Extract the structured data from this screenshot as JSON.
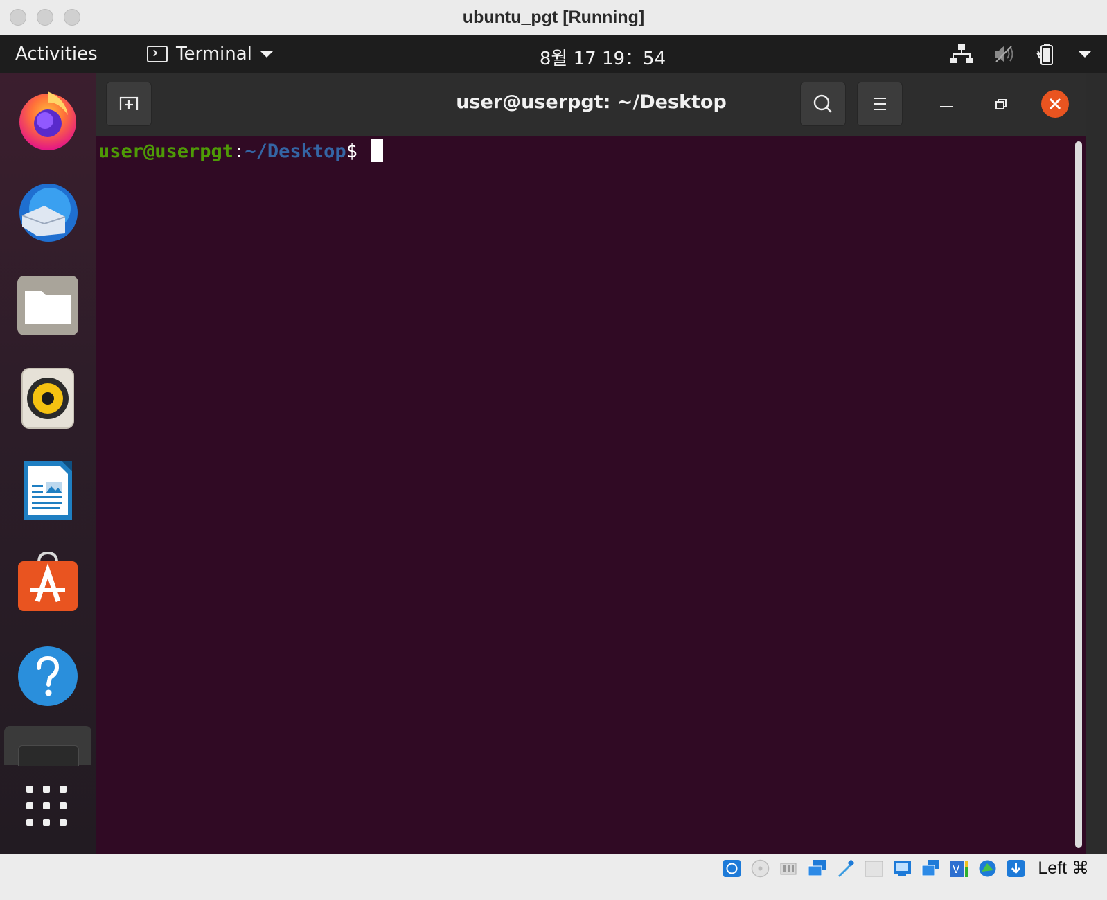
{
  "host": {
    "title": "ubuntu_pgt [Running]",
    "host_key_label": "Left ⌘",
    "status_icons": [
      "hard-disk-icon",
      "optical-disk-icon",
      "audio-icon",
      "network-icon",
      "usb-icon",
      "shared-folders-icon",
      "display-icon",
      "capture-icon",
      "video-capture-icon",
      "guest-additions-icon",
      "mouse-integration-icon"
    ]
  },
  "topbar": {
    "activities": "Activities",
    "app_menu": "Terminal",
    "clock": "8월 17  19：54",
    "tray_icons": [
      "network-wired-icon",
      "volume-muted-icon",
      "battery-icon",
      "system-menu-caret-icon"
    ]
  },
  "dock": {
    "apps": [
      "Firefox",
      "Thunderbird",
      "Files",
      "Rhythmbox",
      "LibreOffice Writer",
      "Ubuntu Software",
      "Help",
      "Terminal"
    ],
    "show_apps": "Show Applications"
  },
  "terminal": {
    "title": "user@userpgt: ~/Desktop",
    "prompt_user": "user@userpgt",
    "prompt_colon": ":",
    "prompt_path": "~/Desktop",
    "prompt_dollar": "$ ",
    "colors": {
      "bg": "#300a24",
      "user": "#4e9a06",
      "path": "#3465a4"
    }
  }
}
